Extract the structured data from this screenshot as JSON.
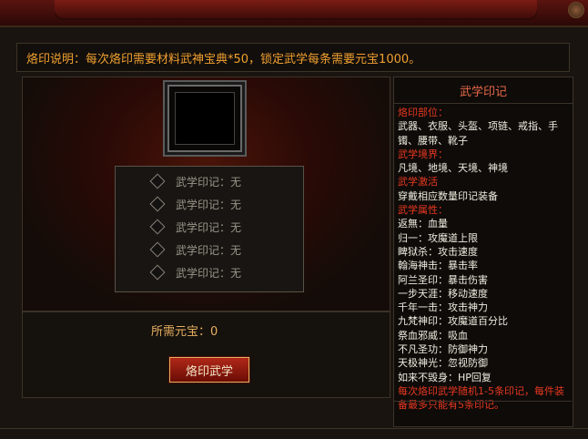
{
  "notice": "烙印说明：每次烙印需要材料武神宝典*50，锁定武学每条需要元宝1000。",
  "slots": [
    {
      "label": "武学印记：无"
    },
    {
      "label": "武学印记：无"
    },
    {
      "label": "武学印记：无"
    },
    {
      "label": "武学印记：无"
    },
    {
      "label": "武学印记：无"
    }
  ],
  "cost": {
    "label": "所需元宝：",
    "value": "0"
  },
  "button_label": "烙印武学",
  "info": {
    "title": "武学印记",
    "h_parts": "烙印部位：",
    "parts_line1": "武器、衣服、头盔、项链、戒指、手",
    "parts_line2": "镯、腰带、靴子",
    "h_realm": "武学境界：",
    "realm_line": "凡境、地境、天境、神境",
    "h_activate": "武学激活",
    "activate_line": "穿戴相应数量印记装备",
    "h_attrs": "武学属性：",
    "attrs": [
      "返無：血量",
      "归一：攻魔道上限",
      "睥狱杀：攻击速度",
      "翰海神击：暴击率",
      "阿兰圣印：暴击伤害",
      "一步天涯：移动速度",
      "千年一击：攻击神力",
      "九梵神印：攻魔道百分比",
      "祭血邪威：吸血",
      "不凡圣功：防御神力",
      "天极神光：忽视防御",
      "如来不毁身：HP回复"
    ],
    "footer_line1": "每次烙印武学随机1-5条印记，每件装",
    "footer_line2": "备最多只能有5条印记。"
  }
}
